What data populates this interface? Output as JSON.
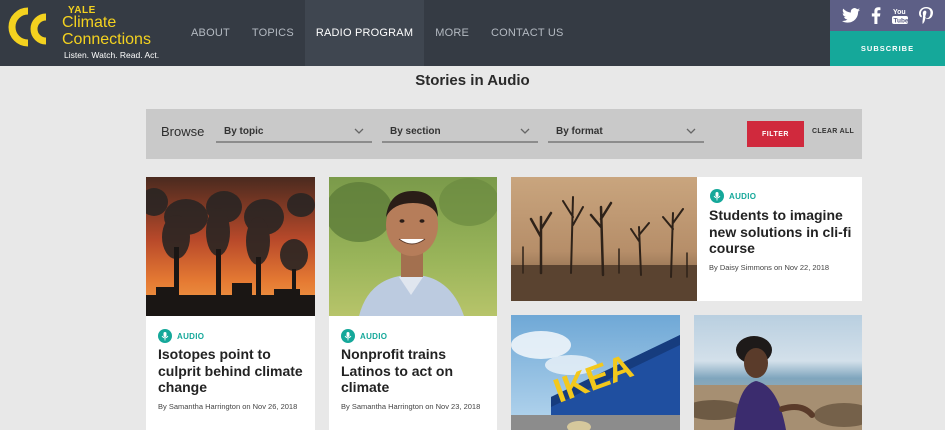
{
  "header": {
    "logo": {
      "yale": "YALE",
      "line1": "Climate",
      "line2": "Connections",
      "tagline": "Listen. Watch. Read. Act."
    },
    "nav": [
      {
        "label": "ABOUT",
        "active": false
      },
      {
        "label": "TOPICS",
        "active": false
      },
      {
        "label": "RADIO PROGRAM",
        "active": true
      },
      {
        "label": "MORE",
        "active": false
      },
      {
        "label": "CONTACT US",
        "active": false
      }
    ],
    "social_icons": [
      "twitter-icon",
      "facebook-icon",
      "youtube-icon",
      "pinterest-icon"
    ],
    "subscribe_label": "SUBSCRIBE"
  },
  "page_title": "Stories in Audio",
  "filters": {
    "browse_label": "Browse",
    "dropdowns": [
      "By topic",
      "By section",
      "By format"
    ],
    "filter_label": "FILTER",
    "clear_label": "CLEAR ALL"
  },
  "cards": [
    {
      "badge": "AUDIO",
      "title_lines": [
        "Isotopes point to",
        "culprit behind climate",
        "change"
      ],
      "byline": "By Samantha Harrington on Nov 26, 2018",
      "image": "smokestacks at sunset"
    },
    {
      "badge": "AUDIO",
      "title_lines": [
        "Nonprofit trains",
        "Latinos to act on",
        "climate"
      ],
      "byline": "By Samantha Harrington on Nov 23, 2018",
      "image": "smiling man outdoors"
    },
    {
      "badge": "AUDIO",
      "title_lines": [
        "Students to imagine",
        "new solutions in cli-fi",
        "course"
      ],
      "byline": "By Daisy Simmons on Nov 22, 2018",
      "image": "dead trees in drought"
    },
    {
      "image": "IKEA store sign",
      "sign_text": "IKEA"
    },
    {
      "image": "woman sitting on beach"
    }
  ],
  "colors": {
    "header_bg": "#353b44",
    "accent_teal": "#15a89a",
    "filter_red": "#d0293d",
    "logo_yellow": "#f4d21f",
    "social_bg": "#5d5f86"
  }
}
